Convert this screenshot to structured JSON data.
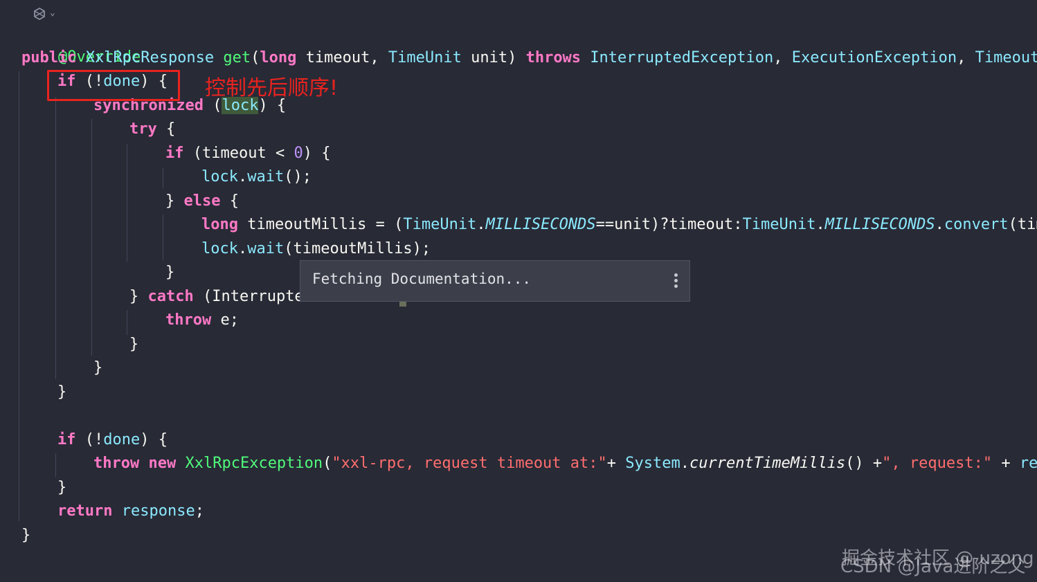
{
  "code": {
    "l1": "@Override",
    "l2_public": "public",
    "l2_type": "XxlRpcResponse",
    "l2_method": "get",
    "l2_long": "long",
    "l2_p1": "timeout",
    "l2_tu": "TimeUnit",
    "l2_p2": "unit",
    "l2_throws": "throws",
    "l2_ex1": "InterruptedException",
    "l2_ex2": "ExecutionException",
    "l2_ex3": "TimeoutEx",
    "l3_if": "if",
    "l3_done": "done",
    "l4_sync": "synchronized",
    "l4_lock": "lock",
    "l5_try": "try",
    "l6_if": "if",
    "l6_timeout": "timeout",
    "l6_zero": "0",
    "l7_lock": "lock",
    "l7_wait": "wait",
    "l8_else": "else",
    "l9_long": "long",
    "l9_var": "timeoutMillis",
    "l9_tu": "TimeUnit",
    "l9_ms": "MILLISECONDS",
    "l9_unit": "==unit)?timeout:",
    "l9_tu2": "TimeUnit",
    "l9_ms2": "MILLISECONDS",
    "l9_convert": "convert",
    "l9_tail": "(time",
    "l10_lock": "lock",
    "l10_wait": "wait",
    "l10_arg": "(timeoutMillis);",
    "l12_catch": "catch",
    "l12_type": "(Interrupte",
    "l13_throw": "throw",
    "l13_e": "e;",
    "l19_if": "if",
    "l19_done": "done",
    "l20_throw": "throw",
    "l20_new": "new",
    "l20_type": "XxlRpcException",
    "l20_str1": "\"xxl-rpc, request timeout at:\"",
    "l20_sys": "System",
    "l20_ctm": "currentTimeMillis",
    "l20_str2": "\", request:\"",
    "l20_tail": "requ",
    "l22_return": "return",
    "l22_resp": "response"
  },
  "annotation": {
    "note": "控制先后顺序!",
    "color": "#e8231f"
  },
  "popup": {
    "text": "Fetching Documentation...",
    "more_icon": "more-vertical-icon"
  },
  "watermarks": {
    "juejin": "掘金技术社区 @ uzong",
    "csdn": "CSDN @Java进阶之父"
  }
}
